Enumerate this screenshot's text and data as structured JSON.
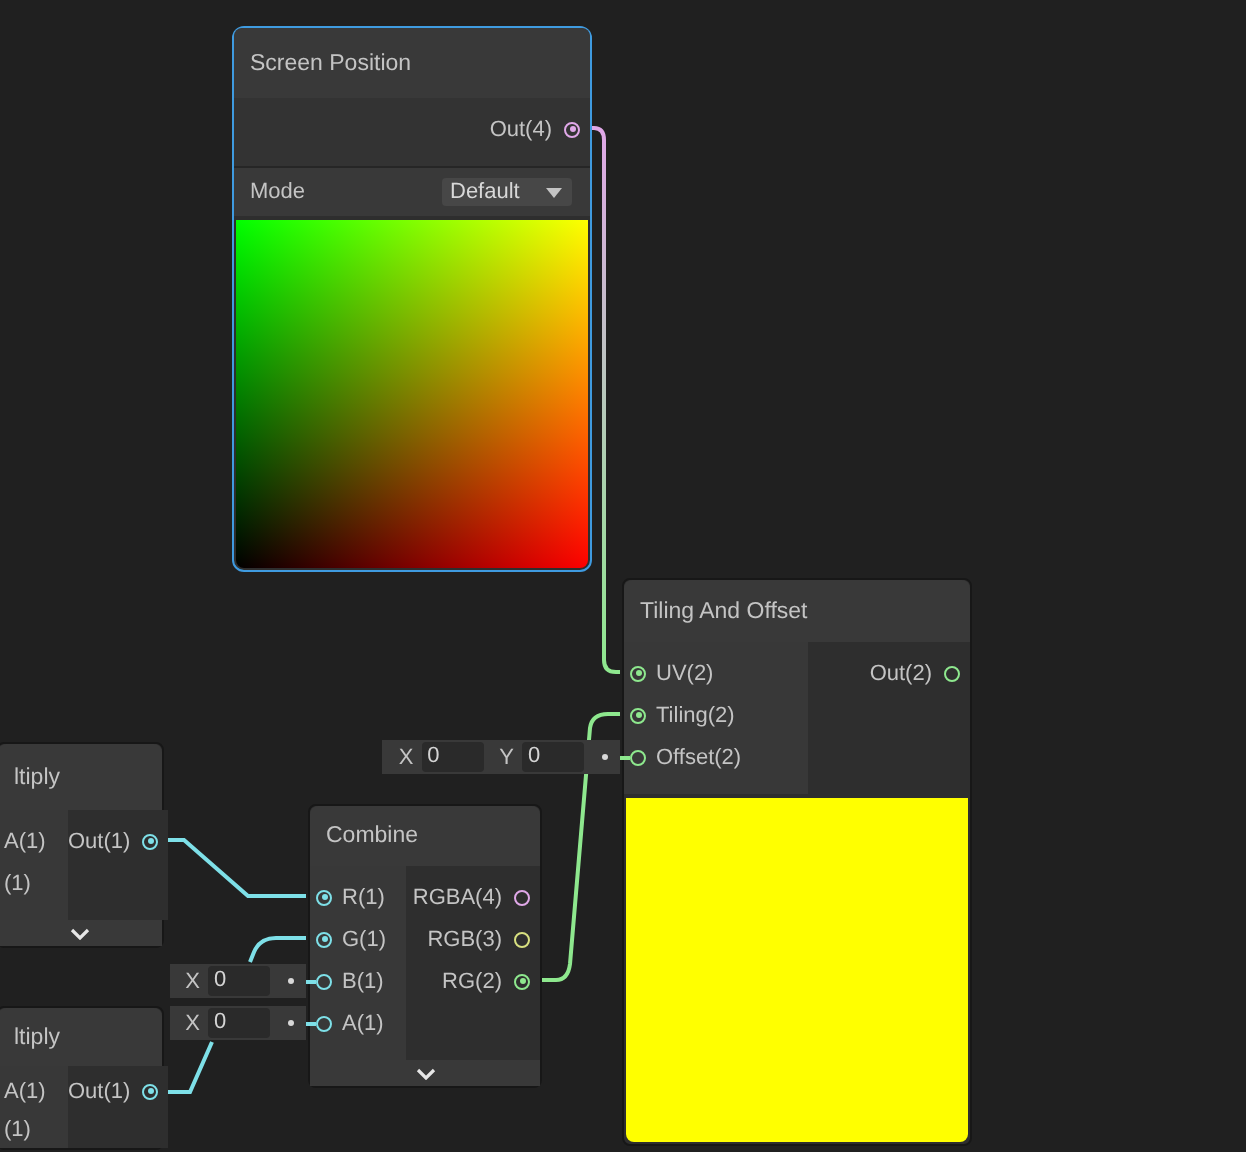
{
  "nodes": [
    {
      "title": "Screen Position",
      "selected": true,
      "outputs": [
        {
          "label": "Out(4)",
          "color": "#e0a8e8",
          "connected": true
        }
      ],
      "settings": [
        {
          "label": "Mode",
          "value": "Default"
        }
      ],
      "preview": {
        "kind": "uv_gradient"
      }
    },
    {
      "title": "Tiling And Offset",
      "selected": false,
      "inputs": [
        {
          "label": "UV(2)",
          "color": "#8ee88e",
          "connected": true
        },
        {
          "label": "Tiling(2)",
          "color": "#8ee88e",
          "connected": true
        },
        {
          "label": "Offset(2)",
          "color": "#8ee88e",
          "connected": false,
          "fields": [
            {
              "axis": "X",
              "value": "0"
            },
            {
              "axis": "Y",
              "value": "0"
            }
          ]
        }
      ],
      "outputs": [
        {
          "label": "Out(2)",
          "color": "#8ee88e",
          "connected": false
        }
      ],
      "preview": {
        "kind": "solid",
        "color": "#ffff00"
      }
    },
    {
      "title": "ltiply",
      "selected": false,
      "inputs": [
        {
          "label": "A(1)"
        },
        {
          "label": "(1)"
        }
      ],
      "outputs": [
        {
          "label": "Out(1)",
          "color": "#7ee0e8",
          "connected": true
        }
      ],
      "expanded": true
    },
    {
      "title": "ltiply",
      "selected": false,
      "inputs": [
        {
          "label": "A(1)"
        },
        {
          "label": "(1)"
        }
      ],
      "outputs": [
        {
          "label": "Out(1)",
          "color": "#7ee0e8",
          "connected": true
        }
      ]
    },
    {
      "title": "Combine",
      "selected": false,
      "inputs": [
        {
          "label": "R(1)",
          "color": "#7ee0e8",
          "connected": true
        },
        {
          "label": "G(1)",
          "color": "#7ee0e8",
          "connected": true
        },
        {
          "label": "B(1)",
          "color": "#7ee0e8",
          "connected": false,
          "fields": [
            {
              "axis": "X",
              "value": "0"
            }
          ]
        },
        {
          "label": "A(1)",
          "color": "#7ee0e8",
          "connected": false,
          "fields": [
            {
              "axis": "X",
              "value": "0"
            }
          ]
        }
      ],
      "outputs": [
        {
          "label": "RGBA(4)",
          "color": "#e0a8e8",
          "connected": false
        },
        {
          "label": "RGB(3)",
          "color": "#d8e080",
          "connected": false
        },
        {
          "label": "RG(2)",
          "color": "#8ee88e",
          "connected": true
        }
      ],
      "expanded": true
    }
  ]
}
